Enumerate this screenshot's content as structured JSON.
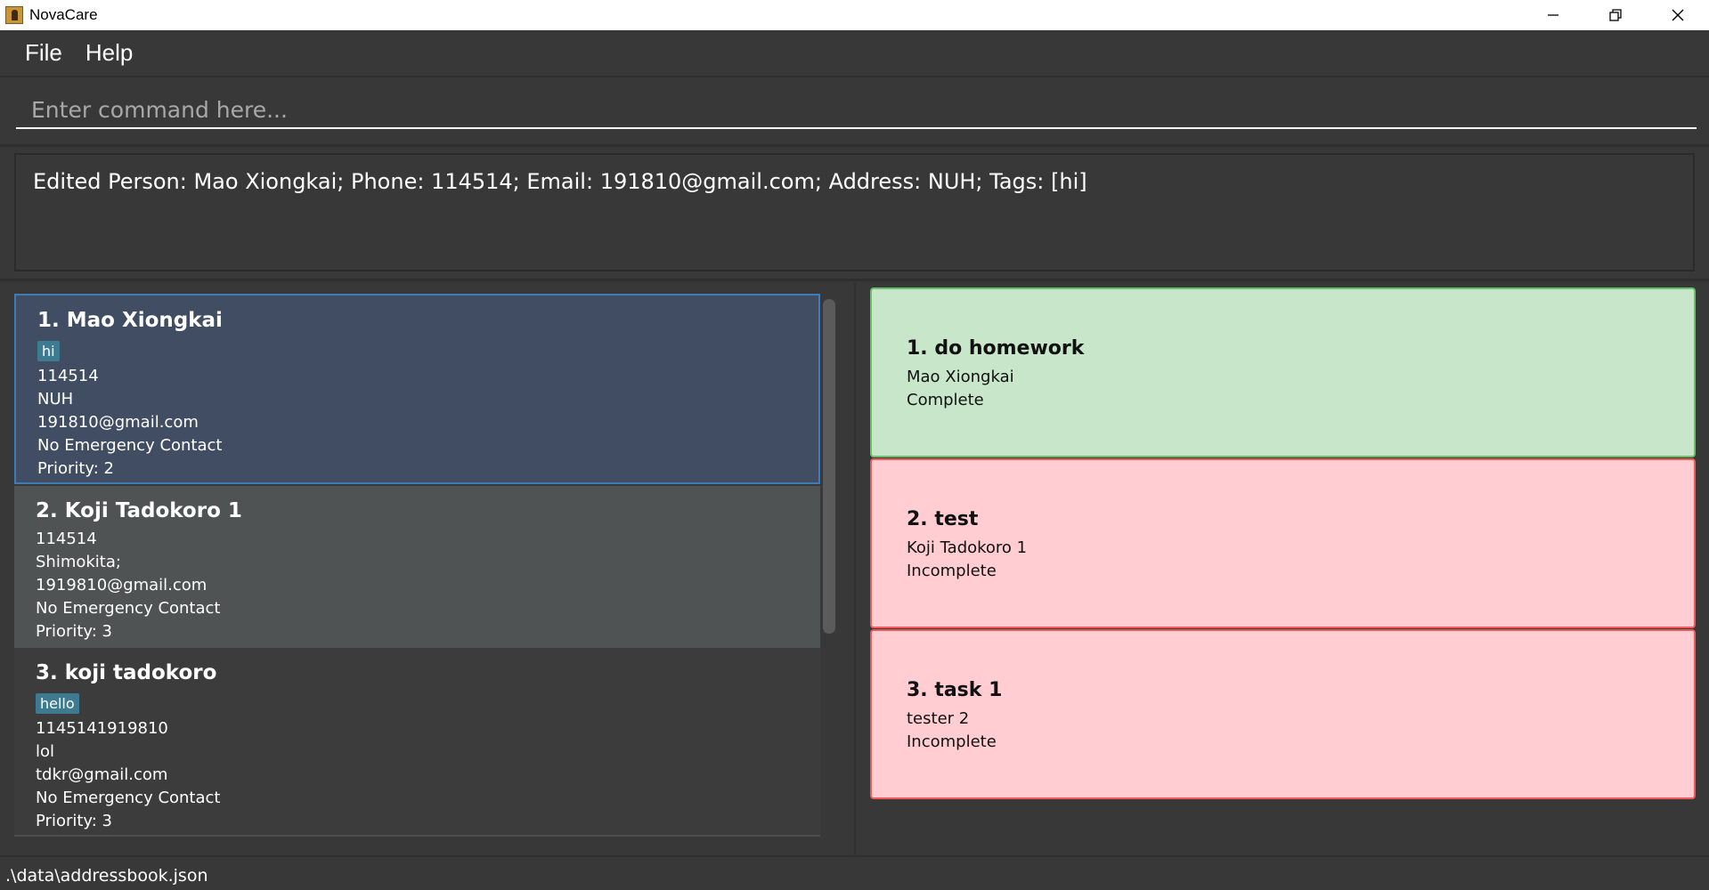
{
  "window": {
    "title": "NovaCare"
  },
  "menu": {
    "items": [
      "File",
      "Help"
    ]
  },
  "command": {
    "placeholder": "Enter command here..."
  },
  "result": {
    "text": "Edited Person: Mao Xiongkai; Phone: 114514; Email: 191810@gmail.com; Address: NUH; Tags: [hi]"
  },
  "persons": [
    {
      "name": "1. Mao Xiongkai",
      "tag": "hi",
      "phone": "114514",
      "address": "NUH",
      "email": "191810@gmail.com",
      "emergency": "No Emergency Contact",
      "priority": "Priority: 2"
    },
    {
      "name": "2. Koji Tadokoro 1",
      "phone": "114514",
      "address": "Shimokita;",
      "email": "1919810@gmail.com",
      "emergency": "No Emergency Contact",
      "priority": "Priority: 3"
    },
    {
      "name": "3. koji tadokoro",
      "tag": "hello",
      "phone": "1145141919810",
      "address": "lol",
      "email": "tdkr@gmail.com",
      "emergency": "No Emergency Contact",
      "priority": "Priority: 3"
    }
  ],
  "tasks": [
    {
      "title": "1. do homework",
      "person": "Mao Xiongkai",
      "status": "Complete"
    },
    {
      "title": "2. test",
      "person": "Koji Tadokoro 1",
      "status": "Incomplete"
    },
    {
      "title": "3. task 1",
      "person": "tester 2",
      "status": "Incomplete"
    }
  ],
  "status_bar": {
    "path": ".\\data\\addressbook.json"
  },
  "colors": {
    "background": "#383838",
    "selected_card": "#414d62",
    "selected_border": "#3d7db4",
    "tag": "#3e7b91",
    "task_complete": "#c8e6c9",
    "task_incomplete": "#ffcdd2"
  }
}
